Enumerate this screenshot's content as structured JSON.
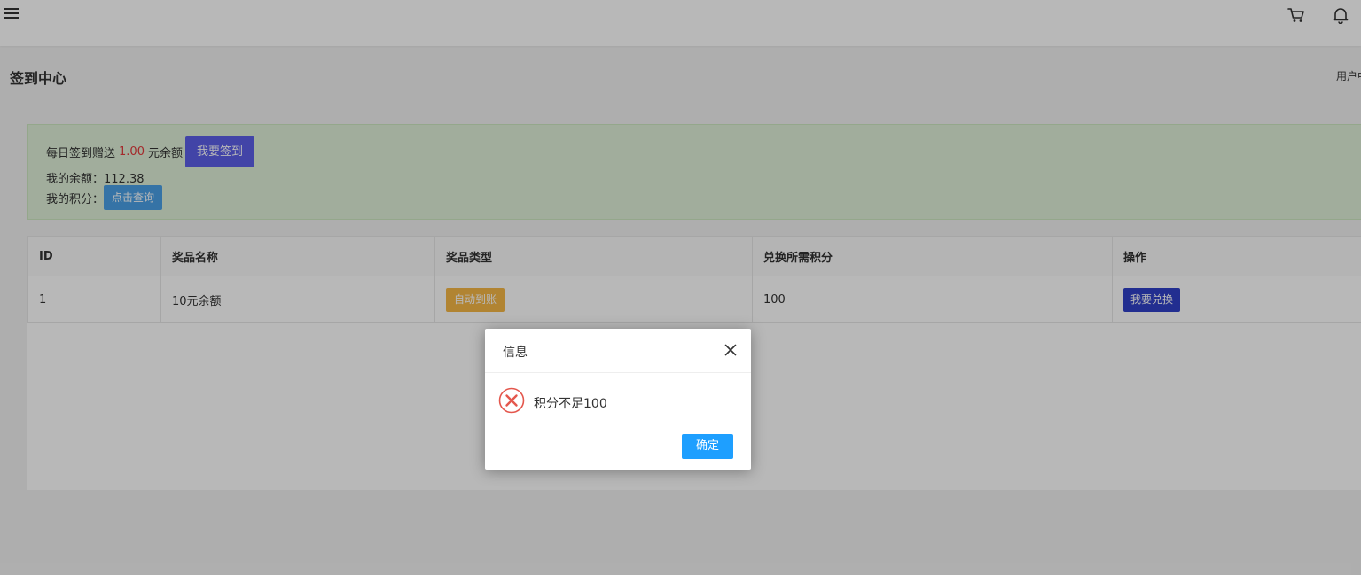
{
  "page": {
    "title": "签到中心",
    "user_link": "用户中心"
  },
  "header": {
    "menu_icon": "hamburger-icon",
    "cart_icon": "cart-icon",
    "bell_icon": "bell-icon"
  },
  "signin": {
    "prefix": "每日签到赠送",
    "amount": "1.00",
    "suffix": "元余额",
    "button": "我要签到",
    "balance_label": "我的余额：",
    "balance_value": "112.38",
    "points_label": "我的积分：",
    "points_button": "点击查询"
  },
  "table": {
    "headers": [
      "ID",
      "奖品名称",
      "奖品类型",
      "兑换所需积分",
      "操作"
    ],
    "rows": [
      {
        "id": "1",
        "name": "10元余额",
        "type": "自动到账",
        "points": "100",
        "action": "我要兑换"
      }
    ]
  },
  "dialog": {
    "title": "信息",
    "message": "积分不足100",
    "ok_button": "确定",
    "icon": "error-circle-icon"
  },
  "colors": {
    "signin_button": "#5c5fe8",
    "query_button": "#4aa0e6",
    "tag_auto": "#f5b746",
    "exchange_button": "#3040c8",
    "ok_button": "#1e9fff",
    "amount": "#e4393c",
    "alert_bg": "#dff0d8"
  }
}
